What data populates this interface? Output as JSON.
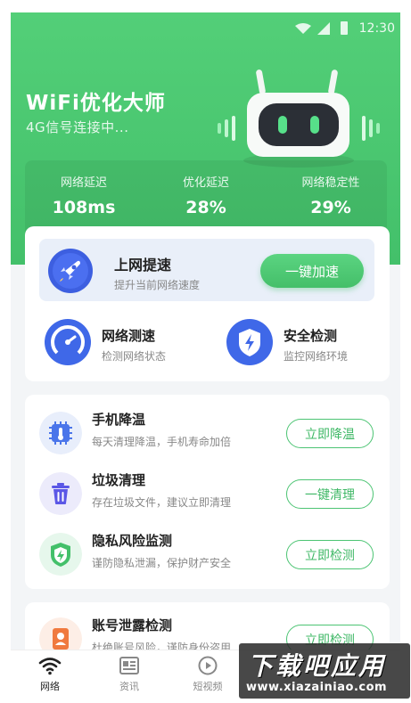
{
  "status_bar": {
    "time": "12:30"
  },
  "header": {
    "title": "WiFi优化大师",
    "subtitle": "4G信号连接中..."
  },
  "stats": [
    {
      "label": "网络延迟",
      "value": "108ms"
    },
    {
      "label": "优化延迟",
      "value": "28%"
    },
    {
      "label": "网络稳定性",
      "value": "29%"
    }
  ],
  "boost": {
    "title": "上网提速",
    "desc": "提升当前网络速度",
    "button": "一键加速"
  },
  "quick_tools": [
    {
      "title": "网络测速",
      "desc": "检测网络状态",
      "icon": "speedometer-icon"
    },
    {
      "title": "安全检测",
      "desc": "监控网络环境",
      "icon": "shield-bolt-icon"
    }
  ],
  "features": [
    {
      "title": "手机降温",
      "desc": "每天清理降温，手机寿命加倍",
      "button": "立即降温",
      "icon": "chip-thermometer-icon"
    },
    {
      "title": "垃圾清理",
      "desc": "存在垃圾文件，建议立即清理",
      "button": "一键清理",
      "icon": "trash-icon"
    },
    {
      "title": "隐私风险监测",
      "desc": "谨防隐私泄漏，保护财产安全",
      "button": "立即检测",
      "icon": "shield-check-icon"
    },
    {
      "title": "账号泄露检测",
      "desc": "杜绝账号风险，谨防身份盗用",
      "button": "立即检测",
      "icon": "id-card-icon"
    }
  ],
  "tabs": [
    {
      "label": "网络",
      "icon": "wifi-icon",
      "active": true
    },
    {
      "label": "资讯",
      "icon": "news-icon",
      "active": false
    },
    {
      "label": "短视频",
      "icon": "play-icon",
      "active": false
    }
  ],
  "watermark": {
    "big": "下载吧应用",
    "small": "www.xiazainiao.com"
  },
  "colors": {
    "accent": "#44bf69",
    "hero": "#4ecb74",
    "boost_bg": "#e9eff9"
  }
}
